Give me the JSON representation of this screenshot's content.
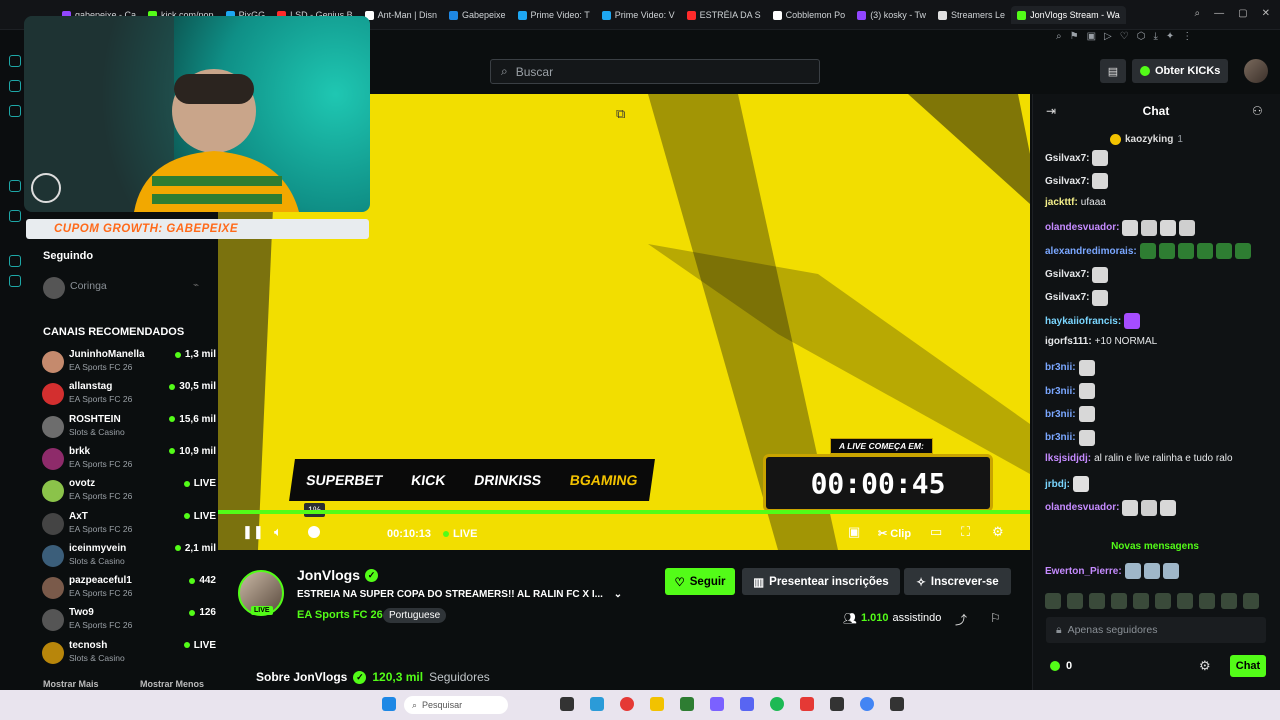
{
  "browser": {
    "tabs": [
      {
        "label": "gabepeixe - Ca",
        "color": "#9146ff"
      },
      {
        "label": "kick.com/pop",
        "color": "#53fc18"
      },
      {
        "label": "PixGG",
        "color": "#1ea7f2"
      },
      {
        "label": "LSD - Genius B",
        "color": "#ff2b2b"
      },
      {
        "label": "Ant-Man | Disn",
        "color": "#ffffff"
      },
      {
        "label": "Gabepeixe",
        "color": "#1e88e5"
      },
      {
        "label": "Prime Video: T",
        "color": "#1ea7f2"
      },
      {
        "label": "Prime Video: V",
        "color": "#1ea7f2"
      },
      {
        "label": "ESTRÉIA DA S",
        "color": "#ff2b2b"
      },
      {
        "label": "Cobblemon Po",
        "color": "#ffffff"
      },
      {
        "label": "(3) kosky - Tw",
        "color": "#9146ff"
      },
      {
        "label": "Streamers Le",
        "color": "#e0e0e0"
      },
      {
        "label": "JonVlogs Stream - Wa",
        "color": "#53fc18",
        "active": true
      }
    ]
  },
  "header": {
    "search_placeholder": "Buscar",
    "kicks_button": "Obter KICKs"
  },
  "overlay": {
    "coupon": "CUPOM GROWTH: GABEPEIXE"
  },
  "sidebar": {
    "following_title": "Seguindo",
    "following_item": "Coringa",
    "recommended_title": "CANAIS RECOMENDADOS",
    "show_more": "Mostrar Mais",
    "show_less": "Mostrar Menos",
    "channels": [
      {
        "name": "JuninhoManella",
        "game": "EA Sports FC 26",
        "viewers": "1,3 mil",
        "color": "#c58a6d"
      },
      {
        "name": "allanstag",
        "game": "EA Sports FC 26",
        "viewers": "30,5 mil",
        "color": "#d32f2f"
      },
      {
        "name": "ROSHTEIN",
        "game": "Slots & Casino",
        "viewers": "15,6 mil",
        "color": "#6d6d6d"
      },
      {
        "name": "brkk",
        "game": "EA Sports FC 26",
        "viewers": "10,9 mil",
        "color": "#8e2b6a"
      },
      {
        "name": "ovotz",
        "game": "EA Sports FC 26",
        "viewers": "LIVE",
        "color": "#8bc34a"
      },
      {
        "name": "AxT",
        "game": "EA Sports FC 26",
        "viewers": "LIVE",
        "color": "#444444"
      },
      {
        "name": "iceinmyvein",
        "game": "Slots & Casino",
        "viewers": "2,1 mil",
        "color": "#3b5e7a"
      },
      {
        "name": "pazpeaceful1",
        "game": "EA Sports FC 26",
        "viewers": "442",
        "color": "#7a5a4a"
      },
      {
        "name": "Two9",
        "game": "EA Sports FC 26",
        "viewers": "126",
        "color": "#555555"
      },
      {
        "name": "tecnosh",
        "game": "Slots & Casino",
        "viewers": "LIVE",
        "color": "#b8860b"
      }
    ]
  },
  "player": {
    "sponsors": [
      "SUPERBET",
      "KICK",
      "DRINKISS",
      "BGAMING"
    ],
    "countdown_label": "A LIVE COMEÇA EM:",
    "countdown": "00:00:45",
    "timecode": "00:10:13",
    "live_label": "LIVE",
    "volume_tooltip": "1%",
    "clip_label": "Clip",
    "progress": 1.0
  },
  "stream": {
    "channel": "JonVlogs",
    "live_badge": "LIVE",
    "title": "ESTREIA NA SUPER COPA DO STREAMERS!! AL RALIN FC X I...",
    "category": "EA Sports FC 26",
    "language": "Portuguese",
    "follow": "Seguir",
    "gift": "Presentear inscrições",
    "subscribe": "Inscrever-se",
    "viewers_count": "1.010",
    "viewers_label": "assistindo",
    "about": "Sobre JonVlogs",
    "followers_count": "120,3 mil",
    "followers_label": "Seguidores"
  },
  "chat": {
    "title": "Chat",
    "pinned_user": "kaozyking",
    "pinned_count": "1",
    "messages": [
      {
        "user": "Gsilvax7:",
        "text": "",
        "color": "#e6e8ea",
        "emotes": 1
      },
      {
        "user": "Gsilvax7:",
        "text": "",
        "color": "#e6e8ea",
        "emotes": 1
      },
      {
        "user": "jackttf:",
        "text": "ufaaa",
        "color": "#f5f08a",
        "emotes": 0
      },
      {
        "user": "olandesvuador:",
        "text": "",
        "color": "#c58bff",
        "emotes": 4
      },
      {
        "user": "alexandredimorais:",
        "text": "",
        "color": "#7aa7ff",
        "emotes": 12
      },
      {
        "user": "Gsilvax7:",
        "text": "",
        "color": "#e6e8ea",
        "emotes": 1
      },
      {
        "user": "Gsilvax7:",
        "text": "",
        "color": "#e6e8ea",
        "emotes": 1
      },
      {
        "user": "haykaiiofrancis:",
        "text": "",
        "color": "#7ad6ff",
        "emotes": 1
      },
      {
        "user": "igorfs111:",
        "text": "+10 NORMAL",
        "color": "#e6e8ea",
        "emotes": 0
      },
      {
        "user": "br3nii:",
        "text": "",
        "color": "#7aa7ff",
        "emotes": 1
      },
      {
        "user": "br3nii:",
        "text": "",
        "color": "#7aa7ff",
        "emotes": 1
      },
      {
        "user": "br3nii:",
        "text": "",
        "color": "#7aa7ff",
        "emotes": 1
      },
      {
        "user": "br3nii:",
        "text": "",
        "color": "#7aa7ff",
        "emotes": 1
      },
      {
        "user": "lksjsidjdj:",
        "text": "al ralin e live ralinha e tudo ralo",
        "color": "#c58bff",
        "emotes": 0
      },
      {
        "user": "jrbdj:",
        "text": "",
        "color": "#7ad6ff",
        "emotes": 1
      },
      {
        "user": "olandesvuador:",
        "text": "",
        "color": "#c58bff",
        "emotes": 3
      }
    ],
    "new_messages": "Novas mensagens",
    "after_new": {
      "user": "Ewerton_Pierre:",
      "color": "#c58bff",
      "emotes": 3
    },
    "input_placeholder": "Apenas seguidores",
    "kicks_count": "0",
    "send_button": "Chat"
  },
  "taskbar": {
    "search": "Pesquisar"
  }
}
